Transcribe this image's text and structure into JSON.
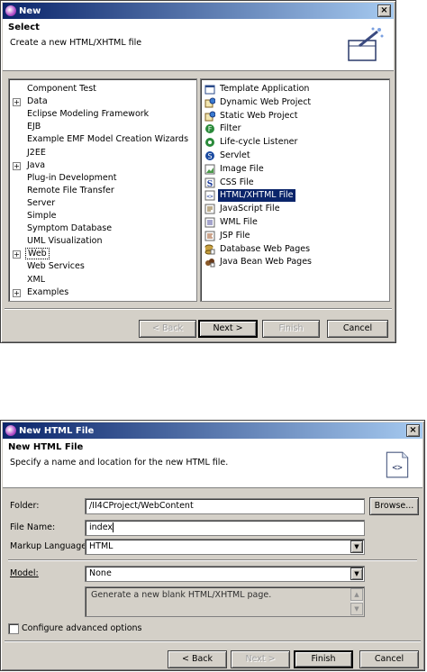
{
  "dialog1": {
    "title": "New",
    "close": "×",
    "banner": {
      "title": "Select",
      "description": "Create a new HTML/XHTML file"
    },
    "left_tree": [
      {
        "label": "Component Test",
        "expandable": false
      },
      {
        "label": "Data",
        "expandable": true
      },
      {
        "label": "Eclipse Modeling Framework",
        "expandable": false
      },
      {
        "label": "EJB",
        "expandable": false
      },
      {
        "label": "Example EMF Model Creation Wizards",
        "expandable": false
      },
      {
        "label": "J2EE",
        "expandable": false
      },
      {
        "label": "Java",
        "expandable": true
      },
      {
        "label": "Plug-in Development",
        "expandable": false
      },
      {
        "label": "Remote File Transfer",
        "expandable": false
      },
      {
        "label": "Server",
        "expandable": false
      },
      {
        "label": "Simple",
        "expandable": false
      },
      {
        "label": "Symptom Database",
        "expandable": false
      },
      {
        "label": "UML Visualization",
        "expandable": false
      },
      {
        "label": "Web",
        "expandable": true
      },
      {
        "label": "Web Services",
        "expandable": false
      },
      {
        "label": "XML",
        "expandable": false
      },
      {
        "label": "Examples",
        "expandable": true
      }
    ],
    "wizards": [
      {
        "label": "Template Application",
        "icon": "template-app-icon"
      },
      {
        "label": "Dynamic Web Project",
        "icon": "web-project-icon"
      },
      {
        "label": "Static Web Project",
        "icon": "web-project-icon"
      },
      {
        "label": "Filter",
        "icon": "filter-icon"
      },
      {
        "label": "Life-cycle Listener",
        "icon": "listener-icon"
      },
      {
        "label": "Servlet",
        "icon": "servlet-icon"
      },
      {
        "label": "Image File",
        "icon": "image-file-icon"
      },
      {
        "label": "CSS File",
        "icon": "css-file-icon"
      },
      {
        "label": "HTML/XHTML File",
        "icon": "html-file-icon"
      },
      {
        "label": "JavaScript File",
        "icon": "javascript-file-icon"
      },
      {
        "label": "WML File",
        "icon": "wml-file-icon"
      },
      {
        "label": "JSP File",
        "icon": "jsp-file-icon"
      },
      {
        "label": "Database Web Pages",
        "icon": "database-pages-icon"
      },
      {
        "label": "Java Bean Web Pages",
        "icon": "javabean-pages-icon"
      }
    ],
    "buttons": {
      "back": "< Back",
      "next": "Next >",
      "finish": "Finish",
      "cancel": "Cancel"
    }
  },
  "dialog2": {
    "title": "New HTML File",
    "close": "×",
    "banner": {
      "title": "New HTML File",
      "description": "Specify a name and location for the new HTML file."
    },
    "form": {
      "folder_label": "Folder:",
      "folder_value": "/II4CProject/WebContent",
      "browse_label": "Browse...",
      "filename_label": "File Name:",
      "filename_value": "index",
      "markup_label": "Markup Language:",
      "markup_value": "HTML",
      "model_label": "Model:",
      "model_value": "None",
      "model_description": "Generate a new blank HTML/XHTML page.",
      "advanced_label": "Configure advanced options"
    },
    "buttons": {
      "back": "< Back",
      "next": "Next >",
      "finish": "Finish",
      "cancel": "Cancel"
    }
  }
}
